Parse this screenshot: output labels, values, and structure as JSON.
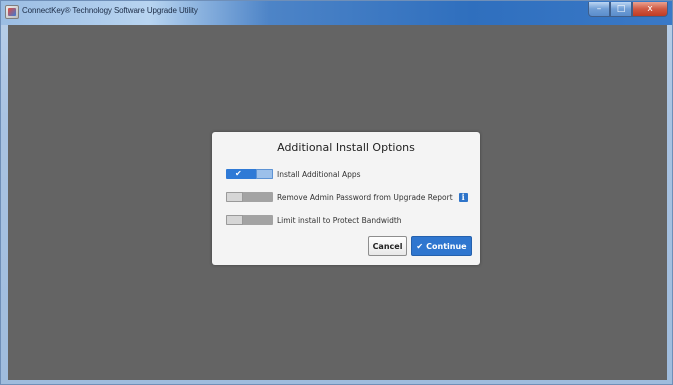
{
  "window": {
    "title": "ConnectKey® Technology Software Upgrade Utility",
    "controls": {
      "minimize": "–",
      "maximize": "□",
      "close": "x"
    }
  },
  "dialog": {
    "title": "Additional Install Options",
    "options": [
      {
        "label": "Install Additional Apps",
        "enabled": true,
        "toggle_mark": "✔"
      },
      {
        "label": "Remove Admin Password from Upgrade Report",
        "enabled": false,
        "info_icon": "i"
      },
      {
        "label": "Limit install to Protect Bandwidth",
        "enabled": false
      }
    ],
    "cancel_label": "Cancel",
    "continue_label": "Continue",
    "continue_icon": "✔"
  },
  "colors": {
    "background": "#646464",
    "accent": "#2f76cf",
    "dialog": "#f4f4f4"
  }
}
